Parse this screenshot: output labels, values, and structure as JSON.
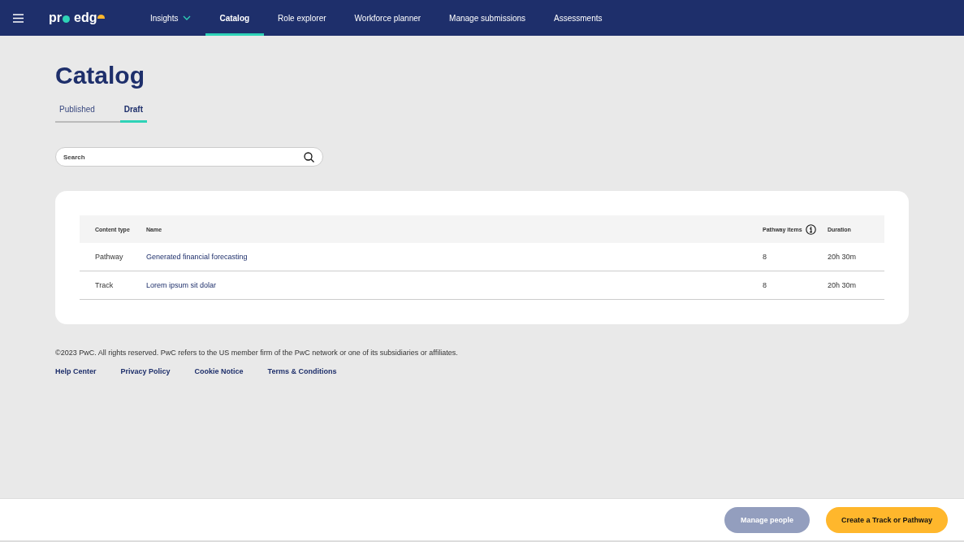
{
  "nav": {
    "logo": {
      "part_1": "pr",
      "part_2": "edg"
    },
    "items": [
      {
        "label": "Insights",
        "selected": false,
        "dropdown": true
      },
      {
        "label": "Catalog",
        "selected": true,
        "dropdown": false
      },
      {
        "label": "Role explorer",
        "selected": false,
        "dropdown": false
      },
      {
        "label": "Workforce planner",
        "selected": false,
        "dropdown": false
      },
      {
        "label": "Manage submissions",
        "selected": false,
        "dropdown": false
      },
      {
        "label": "Assessments",
        "selected": false,
        "dropdown": false
      }
    ]
  },
  "title": "Catalog",
  "tabs": [
    {
      "label": "Published",
      "selected": false
    },
    {
      "label": "Draft",
      "selected": true
    }
  ],
  "search": {
    "placeholder": "Search"
  },
  "table": {
    "columns": [
      "Content type",
      "Name",
      "Pathway items",
      "Duration"
    ],
    "rows": [
      {
        "content_type": "Pathway",
        "name": "Generated financial forecasting",
        "pathway_items": "8",
        "duration": "20h 30m"
      },
      {
        "content_type": "Track",
        "name": "Lorem ipsum sit dolar",
        "pathway_items": "8",
        "duration": "20h 30m"
      }
    ]
  },
  "footer": {
    "copyright": "©2023 PwC. All rights reserved. PwC refers to the US member firm of the PwC network or one of its subsidiaries or affiliates.",
    "links": [
      "Help Center",
      "Privacy Policy",
      "Cookie Notice",
      "Terms & Conditions"
    ]
  },
  "actions": [
    {
      "label": "Manage people",
      "kind": "secondary",
      "disabled": true
    },
    {
      "label": "Create a Track or Pathway",
      "kind": "primary",
      "disabled": false
    }
  ]
}
